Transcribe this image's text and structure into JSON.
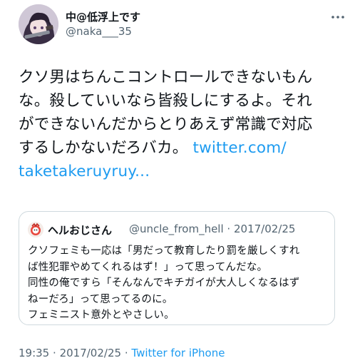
{
  "tweet": {
    "display_name": "中@低浮上です",
    "handle": "@naka___35",
    "text_lines": [
      "クソ男はちんこコントロールできないもん",
      "な。殺していいなら皆殺しにするよ。それ",
      "ができないんだからとりあえず常識で対応",
      "するしかないだろバカ。"
    ],
    "link_part1": "twitter.com/",
    "link_part2": "taketakeruyruy..."
  },
  "quoted": {
    "display_name": "ヘルおじさん",
    "handle": "@uncle_from_hell",
    "separator": "·",
    "date": "2017/02/25",
    "text_lines": [
      "クソフェミも一応は「男だって教育したり罰を厳しくすれ",
      "ば性犯罪やめてくれるはず！」って思ってんだな。",
      "同性の俺ですら「そんなんでキチガイが大人しくなるはず",
      "ねーだろ」って思ってるのに。",
      "フェミニスト意外とやさしい。"
    ]
  },
  "footer": {
    "time": "19:35",
    "separator": "·",
    "date": "2017/02/25",
    "source": "Twitter for iPhone"
  }
}
